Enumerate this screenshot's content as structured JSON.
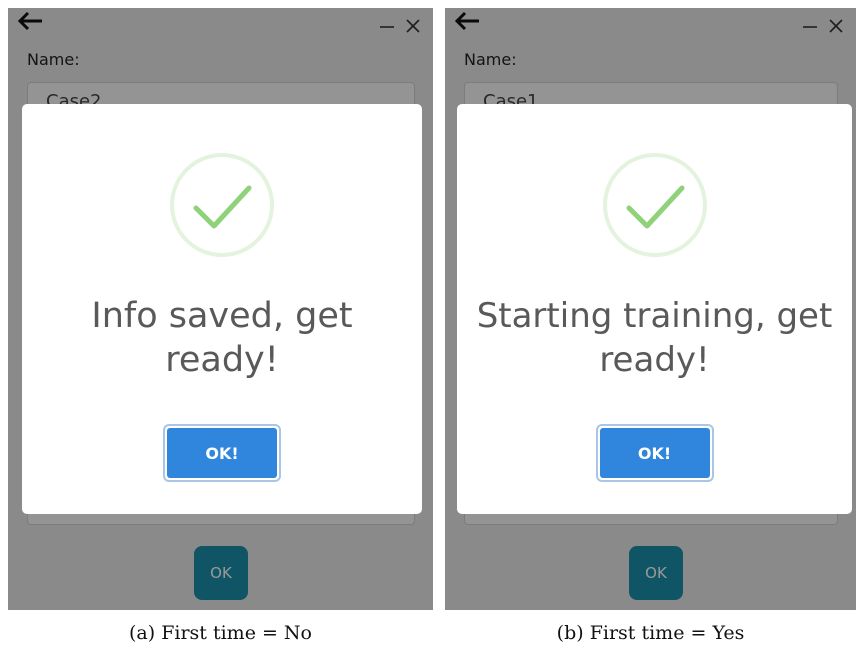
{
  "panels": [
    {
      "id": "a",
      "name_label": "Name:",
      "name_value": "Case2",
      "underlay_ok_label": "OK",
      "dialog": {
        "message": "Info saved, get ready!",
        "ok_label": "OK!"
      },
      "caption": "(a) First time = No"
    },
    {
      "id": "b",
      "name_label": "Name:",
      "name_value": "Case1",
      "underlay_ok_label": "OK",
      "dialog": {
        "message": "Starting training, get ready!",
        "ok_label": "OK!"
      },
      "caption": "(b) First time = Yes"
    }
  ],
  "colors": {
    "accent": "#2f86dc",
    "success": "#8fd27a",
    "underlay_button": "#1b8ea8",
    "overlay": "rgba(0,0,0,0.4)"
  },
  "icons": {
    "back": "arrow-left-icon",
    "minimize": "minimize-icon",
    "close": "close-icon",
    "success": "check-circle-icon"
  }
}
